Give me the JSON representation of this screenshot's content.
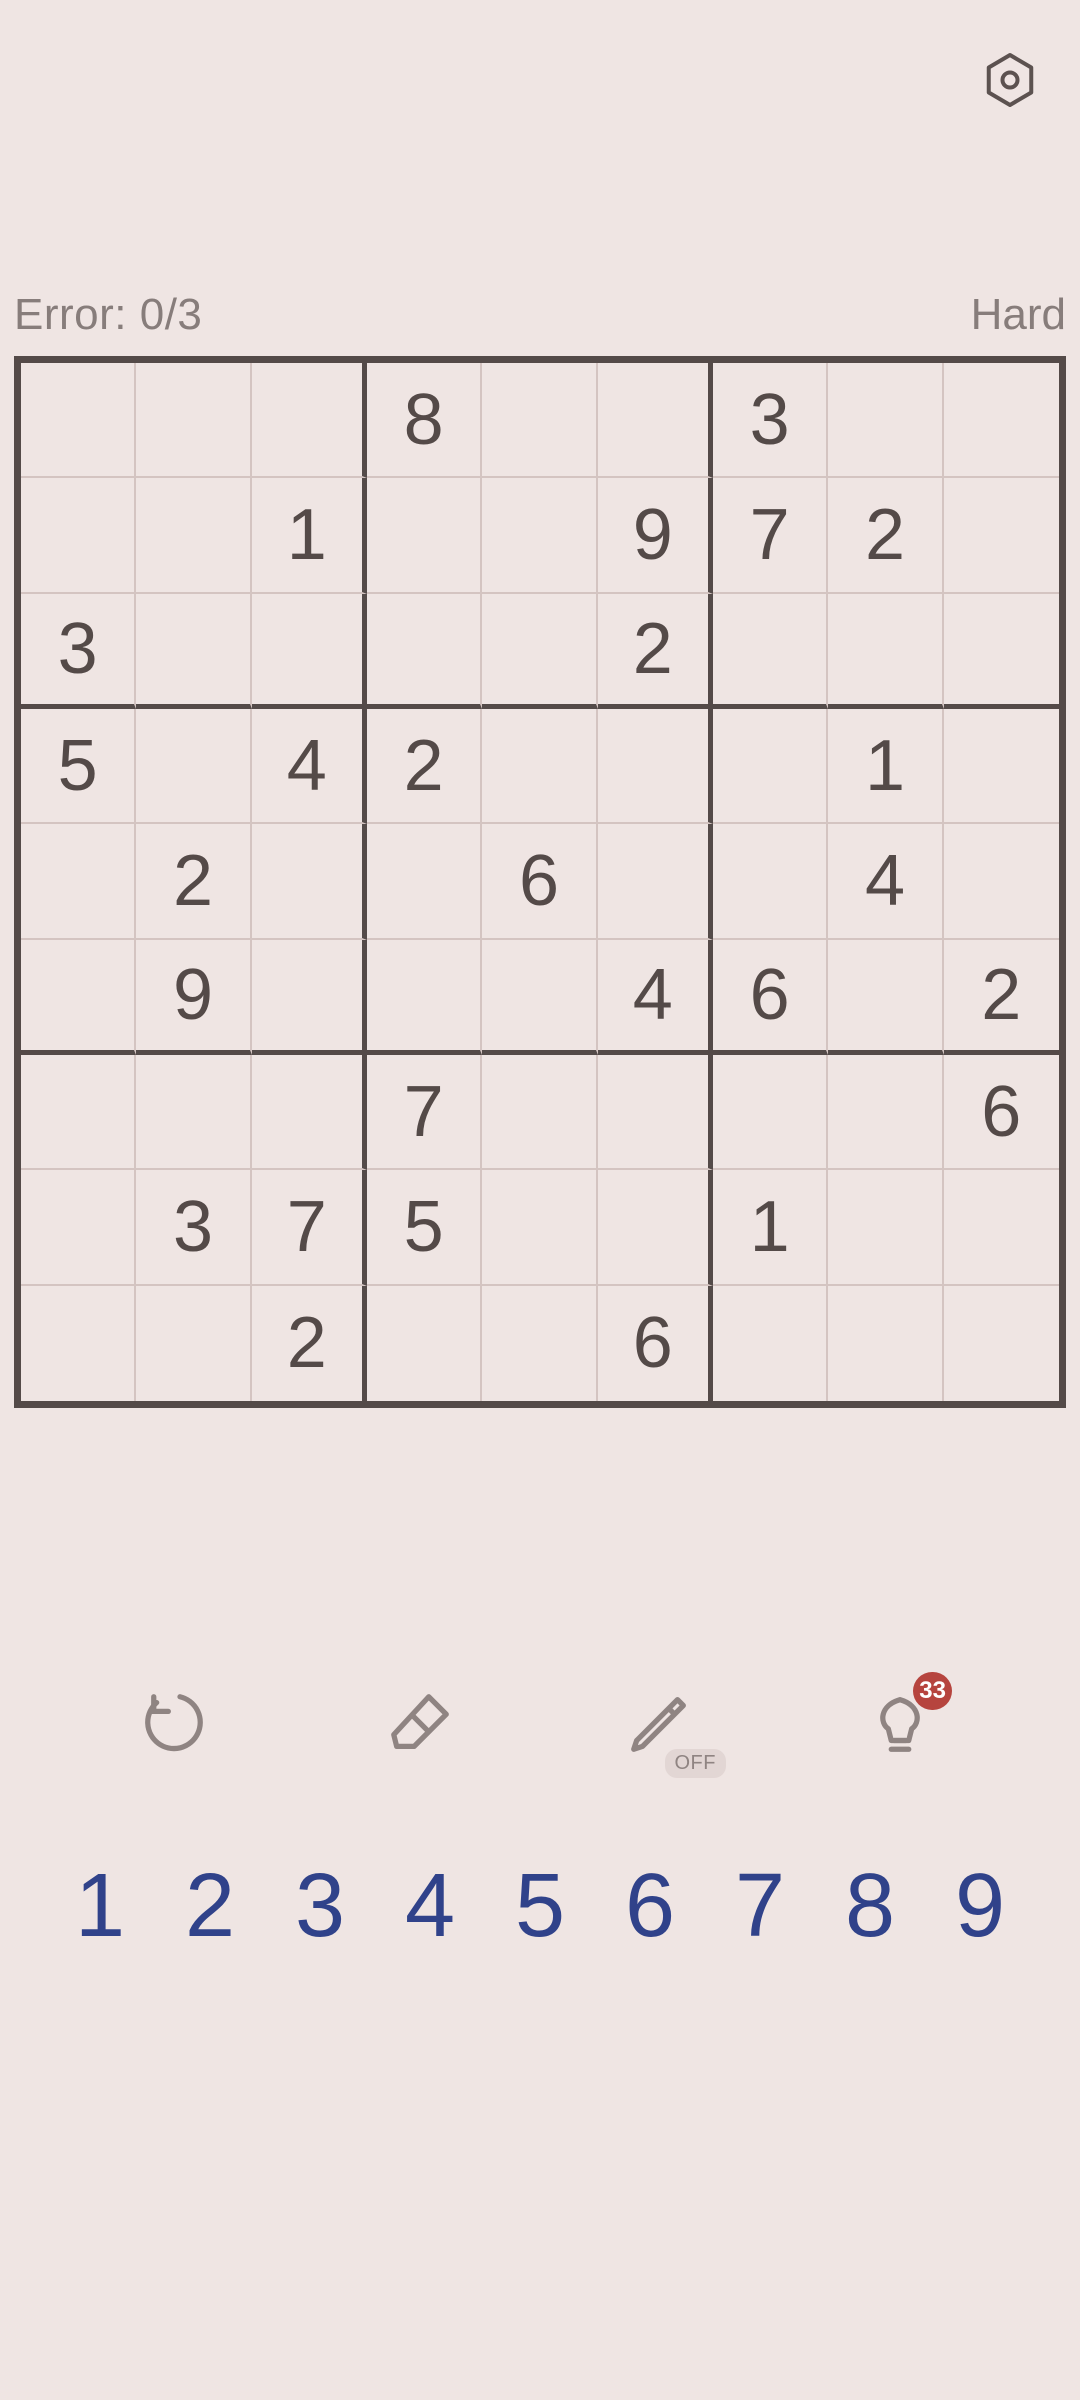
{
  "header": {
    "settings_icon": "settings"
  },
  "status": {
    "error_label": "Error:",
    "error_value": "0/3",
    "difficulty": "Hard"
  },
  "board": [
    [
      "",
      "",
      "",
      "8",
      "",
      "",
      "3",
      "",
      ""
    ],
    [
      "",
      "",
      "1",
      "",
      "",
      "9",
      "7",
      "2",
      ""
    ],
    [
      "3",
      "",
      "",
      "",
      "",
      "2",
      "",
      "",
      ""
    ],
    [
      "5",
      "",
      "4",
      "2",
      "",
      "",
      "",
      "1",
      ""
    ],
    [
      "",
      "2",
      "",
      "",
      "6",
      "",
      "",
      "4",
      ""
    ],
    [
      "",
      "9",
      "",
      "",
      "",
      "4",
      "6",
      "",
      "2"
    ],
    [
      "",
      "",
      "",
      "7",
      "",
      "",
      "",
      "",
      "6"
    ],
    [
      "",
      "3",
      "7",
      "5",
      "",
      "",
      "1",
      "",
      ""
    ],
    [
      "",
      "",
      "2",
      "",
      "",
      "6",
      "",
      "",
      ""
    ]
  ],
  "toolbar": {
    "undo": "undo",
    "erase": "erase",
    "pencil": "pencil",
    "pencil_state": "OFF",
    "hint": "hint",
    "hint_count": "33"
  },
  "numpad": [
    "1",
    "2",
    "3",
    "4",
    "5",
    "6",
    "7",
    "8",
    "9"
  ],
  "colors": {
    "bg": "#efe5e3",
    "grid_dark": "#544a48",
    "grid_light": "#d4c4c1",
    "text_muted": "#877d7b",
    "numpad": "#30428a",
    "badge": "#b6443e"
  }
}
